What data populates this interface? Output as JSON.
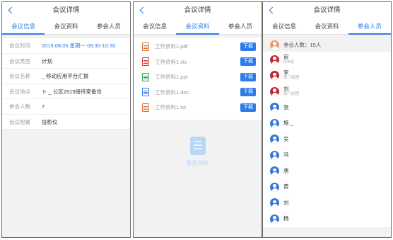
{
  "header": {
    "title": "会议详情"
  },
  "tabs": [
    "会议信息",
    "会议资料",
    "参会人员"
  ],
  "info": [
    {
      "label": "会议时间",
      "value": "2019.08.05 星期一 09:30-10:30",
      "highlight": true
    },
    {
      "label": "会议类型",
      "value": "计划"
    },
    {
      "label": "会议名称",
      "value": "_ 移动应用平台汇报"
    },
    {
      "label": "会议地点",
      "value": "ト _ 公区2515接待室备份"
    },
    {
      "label": "参会人数",
      "value": "7"
    },
    {
      "label": "会议配置",
      "value": "投影仪"
    }
  ],
  "files": {
    "download_label": "下载",
    "items": [
      {
        "name": "工作资料1.pdf",
        "color": "#e06a2b"
      },
      {
        "name": "工作资料1.xls",
        "color": "#d13438"
      },
      {
        "name": "工作资料1.ppt",
        "color": "#2e9b4b"
      },
      {
        "name": "工作资料1.doc",
        "color": "#2f7ce6"
      },
      {
        "name": "工作资料1.txt",
        "color": "#e06a2b"
      }
    ],
    "empty_text": "暂无资料"
  },
  "attendees": {
    "count_text": "参会人数：15人",
    "people": [
      {
        "name": "宙   ",
        "sub": "Drill接",
        "color": "red"
      },
      {
        "name": "李   ",
        "sub": "第门经理",
        "color": "red"
      },
      {
        "name": "刘   ",
        "sub": "部门经理",
        "color": "red"
      },
      {
        "name": "张   ",
        "sub": "",
        "color": "blue"
      },
      {
        "name": "施  _",
        "sub": "",
        "color": "blue"
      },
      {
        "name": "吴  ",
        "sub": "",
        "color": "blue"
      },
      {
        "name": "冯  ",
        "sub": "",
        "color": "blue"
      },
      {
        "name": "唐  ",
        "sub": "",
        "color": "blue"
      },
      {
        "name": "黄  ",
        "sub": "",
        "color": "blue"
      },
      {
        "name": "刘  ",
        "sub": "",
        "color": "blue"
      },
      {
        "name": "杨  ",
        "sub": "",
        "color": "blue"
      }
    ]
  },
  "colors": {
    "accent": "#2f7ce6",
    "red_avatar": "#c6262c",
    "blue_avatar": "#3877d6"
  }
}
